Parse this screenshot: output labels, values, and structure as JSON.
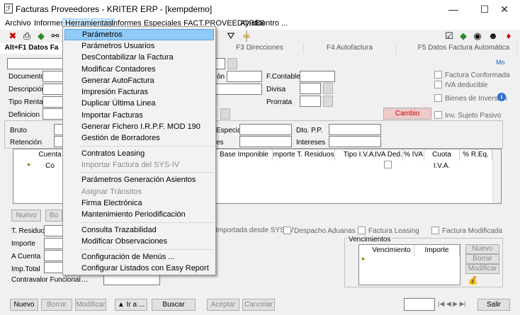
{
  "window": {
    "title": "Facturas Proveedores - KRITER ERP - [kempdemo]",
    "minimize": "—",
    "maximize": "☐",
    "close": "✕"
  },
  "menubar": [
    "Archivo",
    "Informes",
    "Herramientas",
    "Informes Especiales FACT.PROVEEDORES",
    "Ayuda",
    "Centro ..."
  ],
  "tabs": {
    "t1": "Alt+F1 Datos Fa",
    "t3": "F3 Direcciones",
    "t4": "F4 Autofactura",
    "t5": "F5 Datos Factura Automática"
  },
  "header_fields": {
    "documento": "Documento",
    "descripcion": "Descripción",
    "tipo_renta": "Tipo Renta",
    "definicion": "Definicion",
    "fecha_partial": "ón",
    "f_contable": "F.Contable",
    "divisa": "Divisa",
    "prorrata": "Prorrata",
    "cambio": "Cambio"
  },
  "checkboxes_right": [
    "Factura Conformada",
    "IVA deducible",
    "Bienes de Inversión",
    "Inv. Sujeto Pasivo"
  ],
  "mid_fields": {
    "bruto": "Bruto",
    "retencion": "Retención",
    "especial": "Especial",
    "es_partial": "es",
    "dto_pp": "Dto. P.P.",
    "intereses": "Intereses"
  },
  "grid": {
    "headers": [
      "Cuenta Co",
      "Base Imponible",
      "mporte T. Residuos",
      "Tipo I.V.A.",
      "IVA Ded.",
      "% IVA",
      "Cuota I.V.A.",
      "% R.Eq."
    ]
  },
  "grid_buttons": {
    "nuevo": "Nuevo",
    "borrar": "Bo"
  },
  "bottom_fields": {
    "t_residuos": "T. Residuos",
    "importe": "Importe",
    "a_cuenta": "A Cuenta",
    "imp_total": "Imp.Total",
    "contravalor": "Contravalor Funcional"
  },
  "bottom_checks": [
    "Importada desde SYS-IV",
    "Despacho Aduanas",
    "Factura Leasing",
    "Factura Modificada"
  ],
  "vencimientos": {
    "title": "Vencimientos",
    "col1": "Vencimiento",
    "col2": "Importe",
    "nuevo": "Nuevo",
    "borrar": "Borrar",
    "modificar": "Modificar"
  },
  "footer": {
    "nuevo": "Nuevo",
    "borrar": "Borrar",
    "modificar": "Modificar",
    "ira": "▲ Ir a ...",
    "buscar": "Buscar",
    "aceptar": "Aceptar",
    "cancelar": "Cancelar",
    "salir": "Salir",
    "nav": "|◀ ◀ ▶ ▶|"
  },
  "dropdown": {
    "items": [
      {
        "label": "Parámetros",
        "state": "highlighted"
      },
      {
        "label": "Parámetros Usuarios"
      },
      {
        "label": "DesContabilizar la Factura"
      },
      {
        "label": "Modificar Contadores"
      },
      {
        "label": "Generar AutoFactura"
      },
      {
        "label": "Impresión Facturas"
      },
      {
        "label": "Duplicar Última Linea"
      },
      {
        "label": "Importar Facturas"
      },
      {
        "label": "Generar Fichero I.R.P.F. MOD 190"
      },
      {
        "label": "Gestión de Borradores"
      },
      {
        "label": "Contratos Leasing"
      },
      {
        "label": "Importar Factura del SYS-IV",
        "state": "disabled"
      },
      {
        "label": "Parámetros Generación Asientos"
      },
      {
        "label": "Asignar Tránsitos",
        "state": "disabled"
      },
      {
        "label": "Firma Electrónica"
      },
      {
        "label": "Mantenimiento Periodificación"
      },
      {
        "label": "Consulta Trazabilidad"
      },
      {
        "label": "Modificar Observaciones"
      },
      {
        "label": "Configuración de Menús ..."
      },
      {
        "label": "Configurar Listados con Easy Report ..."
      }
    ]
  }
}
